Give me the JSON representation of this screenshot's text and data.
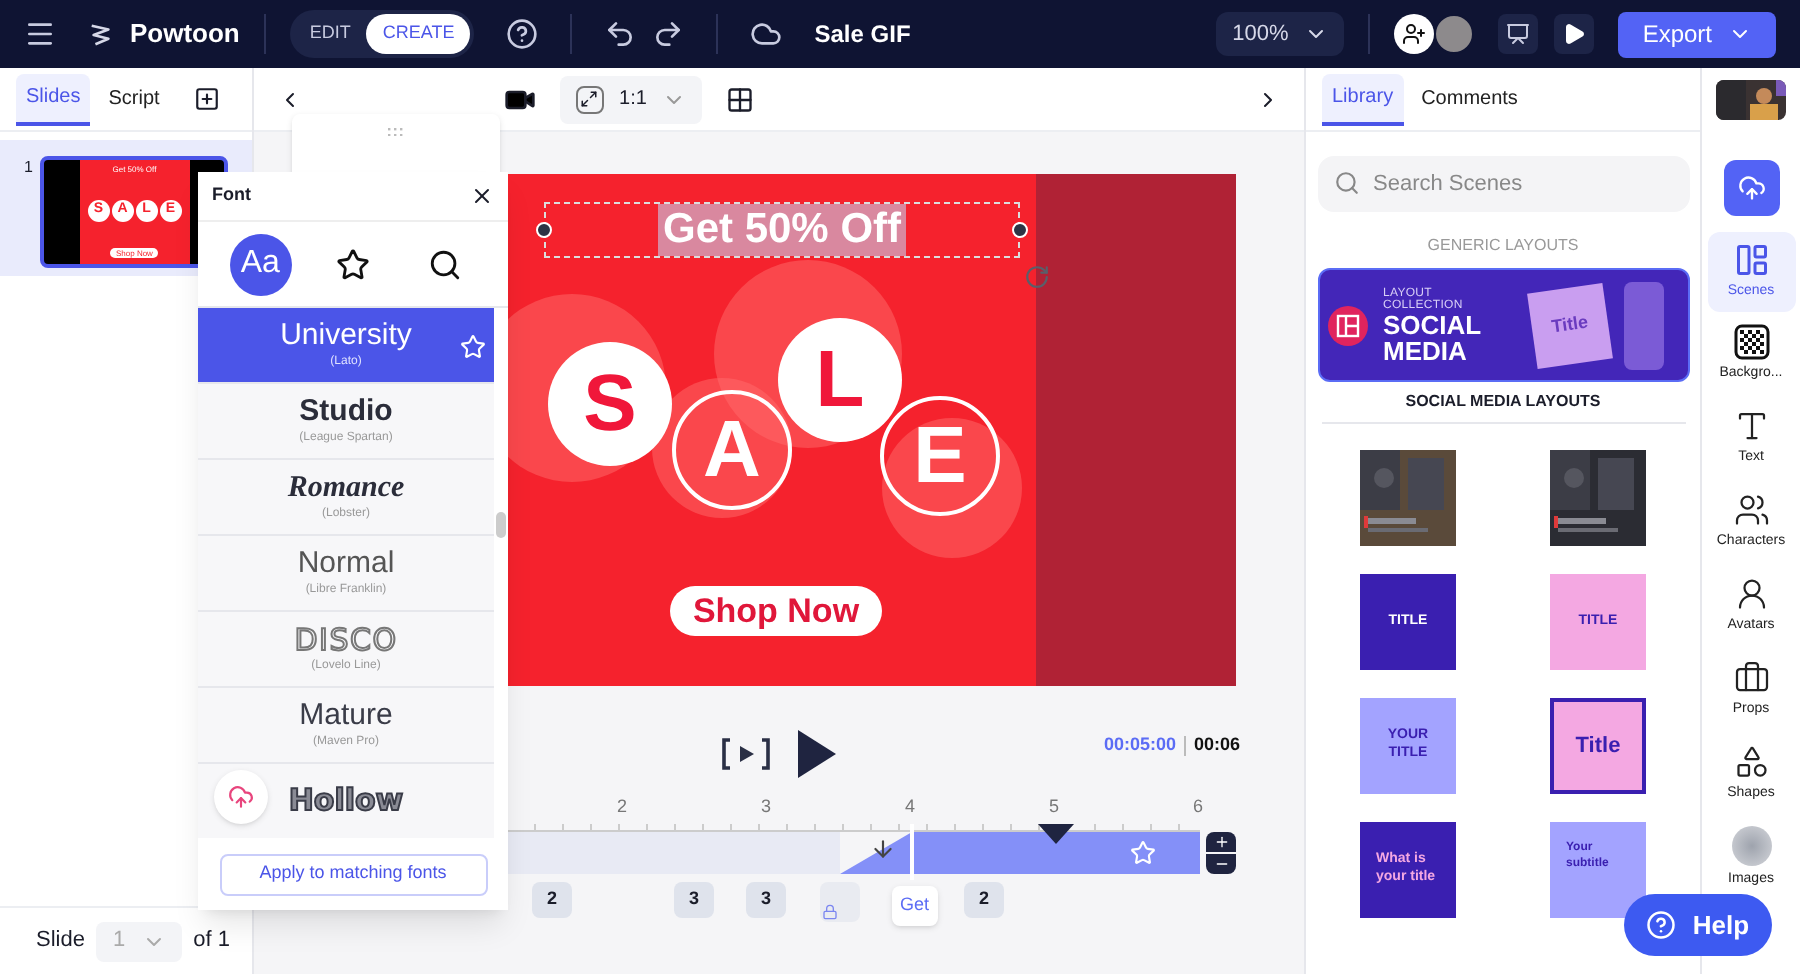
{
  "topbar": {
    "app_name": "Powtoon",
    "modes": [
      {
        "label": "EDIT",
        "selected": false
      },
      {
        "label": "CREATE",
        "selected": true
      }
    ],
    "project_title": "Sale GIF",
    "zoom": "100%",
    "export_label": "Export"
  },
  "left_panel": {
    "tabs": [
      {
        "label": "Slides",
        "selected": true
      },
      {
        "label": "Script",
        "selected": false
      }
    ],
    "slides": [
      {
        "number": "1",
        "selected": true,
        "headline": "Get 50% Off",
        "letters": [
          "S",
          "A",
          "L",
          "E"
        ],
        "cta": "Shop Now"
      }
    ],
    "footer": {
      "label": "Slide",
      "current": "1",
      "total": "of 1"
    }
  },
  "toolbar": {
    "aspect": "1:1"
  },
  "font_panel": {
    "title": "Font",
    "tabs": [
      {
        "kind": "fonts",
        "label": "Aa",
        "selected": true
      },
      {
        "kind": "favorites",
        "selected": false
      },
      {
        "kind": "search",
        "selected": false
      }
    ],
    "fonts": [
      {
        "name": "University",
        "family": "(Lato)",
        "kind": "regular",
        "selected": true
      },
      {
        "name": "Studio",
        "family": "(League Spartan)",
        "kind": "heavy",
        "selected": false
      },
      {
        "name": "Romance",
        "family": "(Lobster)",
        "kind": "script",
        "selected": false
      },
      {
        "name": "Normal",
        "family": "(Libre Franklin)",
        "kind": "light",
        "selected": false
      },
      {
        "name": "DISCO",
        "family": "(Lovelo Line)",
        "kind": "outline",
        "selected": false
      },
      {
        "name": "Mature",
        "family": "(Maven Pro)",
        "kind": "regular",
        "selected": false
      },
      {
        "name": "Hollow",
        "kind": "hollow",
        "selected": false
      }
    ],
    "apply_button": "Apply to matching fonts"
  },
  "canvas": {
    "headline": "Get 50% Off",
    "headline_selected": true,
    "letters": [
      {
        "char": "S",
        "kind": "filled"
      },
      {
        "char": "A",
        "kind": "outline"
      },
      {
        "char": "L",
        "kind": "filled"
      },
      {
        "char": "E",
        "kind": "outline"
      }
    ],
    "cta": "Shop Now"
  },
  "playback": {
    "current_time": "00:05:00",
    "total_time": "00:06"
  },
  "timeline": {
    "ticks": [
      "2",
      "3",
      "4",
      "5",
      "6"
    ],
    "items": [
      {
        "kind": "count",
        "label": "2"
      },
      {
        "kind": "count",
        "label": "3"
      },
      {
        "kind": "count",
        "label": "3"
      },
      {
        "kind": "locked"
      },
      {
        "kind": "text",
        "label": "Get"
      },
      {
        "kind": "count",
        "label": "2"
      }
    ]
  },
  "library": {
    "tabs": [
      {
        "label": "Library",
        "selected": true
      },
      {
        "label": "Comments",
        "selected": false
      }
    ],
    "search": {
      "placeholder": "Search Scenes"
    },
    "section_title": "GENERIC LAYOUTS",
    "banner": {
      "eyebrow": "LAYOUT COLLECTION",
      "title": "SOCIAL MEDIA",
      "sample": "Title"
    },
    "banner_caption": "SOCIAL MEDIA LAYOUTS",
    "scenes": [
      {
        "kind": "picture"
      },
      {
        "kind": "picture"
      },
      {
        "kind": "plain",
        "text": "TITLE",
        "color": "#3a1fb0"
      },
      {
        "kind": "plain",
        "text": "TITLE",
        "color": "#f4a8e2"
      },
      {
        "kind": "plain",
        "text": "YOUR TITLE",
        "color": "#a3a3ff"
      },
      {
        "kind": "framed",
        "text": "Title",
        "color": "#f4a8e2"
      },
      {
        "kind": "accent",
        "text": "What is your title",
        "color": "#3a1fb0"
      },
      {
        "kind": "subtitle",
        "text": "Your subtitle",
        "color": "#a3a3ff"
      }
    ]
  },
  "rail": {
    "items": [
      {
        "label": "Scenes",
        "selected": true
      },
      {
        "label": "Backgro...",
        "selected": false
      },
      {
        "label": "Text",
        "selected": false
      },
      {
        "label": "Characters",
        "selected": false
      },
      {
        "label": "Avatars",
        "selected": false
      },
      {
        "label": "Props",
        "selected": false
      },
      {
        "label": "Shapes",
        "selected": false
      },
      {
        "label": "Images",
        "selected": false
      }
    ]
  },
  "help_label": "Help"
}
